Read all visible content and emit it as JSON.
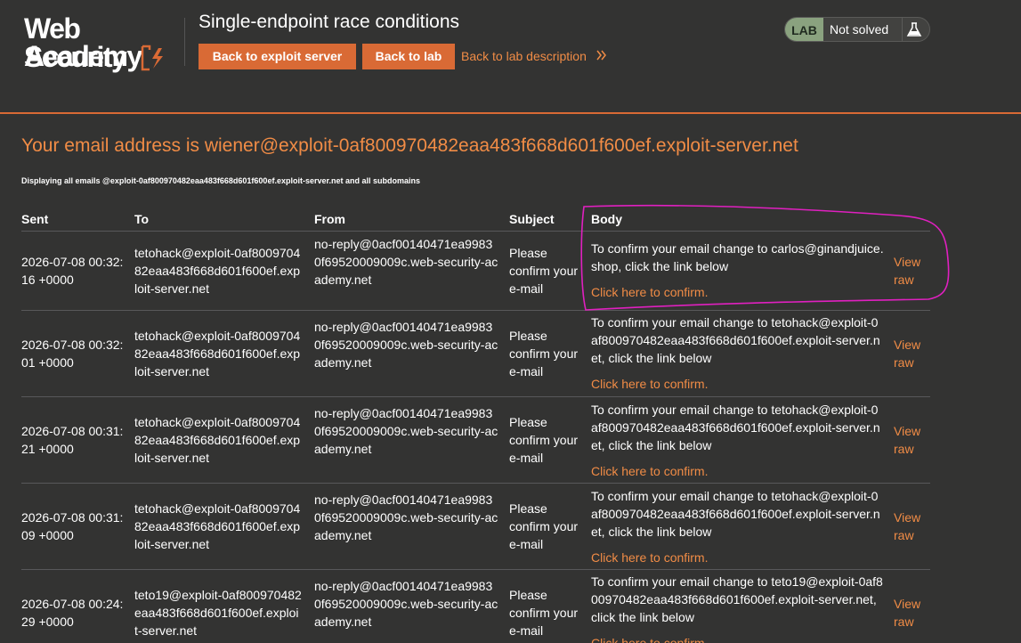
{
  "header": {
    "logo_line1": "Web Security",
    "logo_line2": "Academy",
    "lab_title": "Single-endpoint race conditions",
    "btn_exploit": "Back to exploit server",
    "btn_lab": "Back to lab",
    "back_desc": "Back to lab description",
    "status_badge": "LAB",
    "status_text": "Not solved"
  },
  "main": {
    "email_heading": "Your email address is wiener@exploit-0af800970482eaa483f668d601f600ef.exploit-server.net",
    "subtitle": "Displaying all emails @exploit-0af800970482eaa483f668d601f600ef.exploit-server.net and all subdomains"
  },
  "table": {
    "headers": [
      "Sent",
      "To",
      "From",
      "Subject",
      "Body"
    ],
    "rows": [
      {
        "sent": "2026-07-08 00:32:16 +0000",
        "to": "tetohack@exploit-0af800970482eaa483f668d601f600ef.exploit-server.net",
        "from": "no-reply@0acf00140471ea99830f69520009009c.web-security-academy.net",
        "subject": "Please confirm your e-mail",
        "body": "To confirm your email change to carlos@ginandjuice.shop, click the link below",
        "link": "Click here to confirm.",
        "raw": "View raw"
      },
      {
        "sent": "2026-07-08 00:32:01 +0000",
        "to": "tetohack@exploit-0af800970482eaa483f668d601f600ef.exploit-server.net",
        "from": "no-reply@0acf00140471ea99830f69520009009c.web-security-academy.net",
        "subject": "Please confirm your e-mail",
        "body": "To confirm your email change to tetohack@exploit-0af800970482eaa483f668d601f600ef.exploit-server.net, click the link below",
        "link": "Click here to confirm.",
        "raw": "View raw"
      },
      {
        "sent": "2026-07-08 00:31:21 +0000",
        "to": "tetohack@exploit-0af800970482eaa483f668d601f600ef.exploit-server.net",
        "from": "no-reply@0acf00140471ea99830f69520009009c.web-security-academy.net",
        "subject": "Please confirm your e-mail",
        "body": "To confirm your email change to tetohack@exploit-0af800970482eaa483f668d601f600ef.exploit-server.net, click the link below",
        "link": "Click here to confirm.",
        "raw": "View raw"
      },
      {
        "sent": "2026-07-08 00:31:09 +0000",
        "to": "tetohack@exploit-0af800970482eaa483f668d601f600ef.exploit-server.net",
        "from": "no-reply@0acf00140471ea99830f69520009009c.web-security-academy.net",
        "subject": "Please confirm your e-mail",
        "body": "To confirm your email change to tetohack@exploit-0af800970482eaa483f668d601f600ef.exploit-server.net, click the link below",
        "link": "Click here to confirm.",
        "raw": "View raw"
      },
      {
        "sent": "2026-07-08 00:24:29 +0000",
        "to": "teto19@exploit-0af800970482eaa483f668d601f600ef.exploit-server.net",
        "from": "no-reply@0acf00140471ea99830f69520009009c.web-security-academy.net",
        "subject": "Please confirm your e-mail",
        "body": "To confirm your email change to teto19@exploit-0af800970482eaa483f668d601f600ef.exploit-server.net, click the link below",
        "link": "Click here to confirm.",
        "raw": "View raw"
      }
    ]
  },
  "colors": {
    "accent": "#d96a35",
    "link": "#f18c46",
    "background": "#333332",
    "lab_badge": "#8aa27f",
    "annotation": "#e020c0"
  },
  "icons": [
    "chevron-double-right-icon",
    "flask-icon",
    "logo-bolt-icon"
  ]
}
